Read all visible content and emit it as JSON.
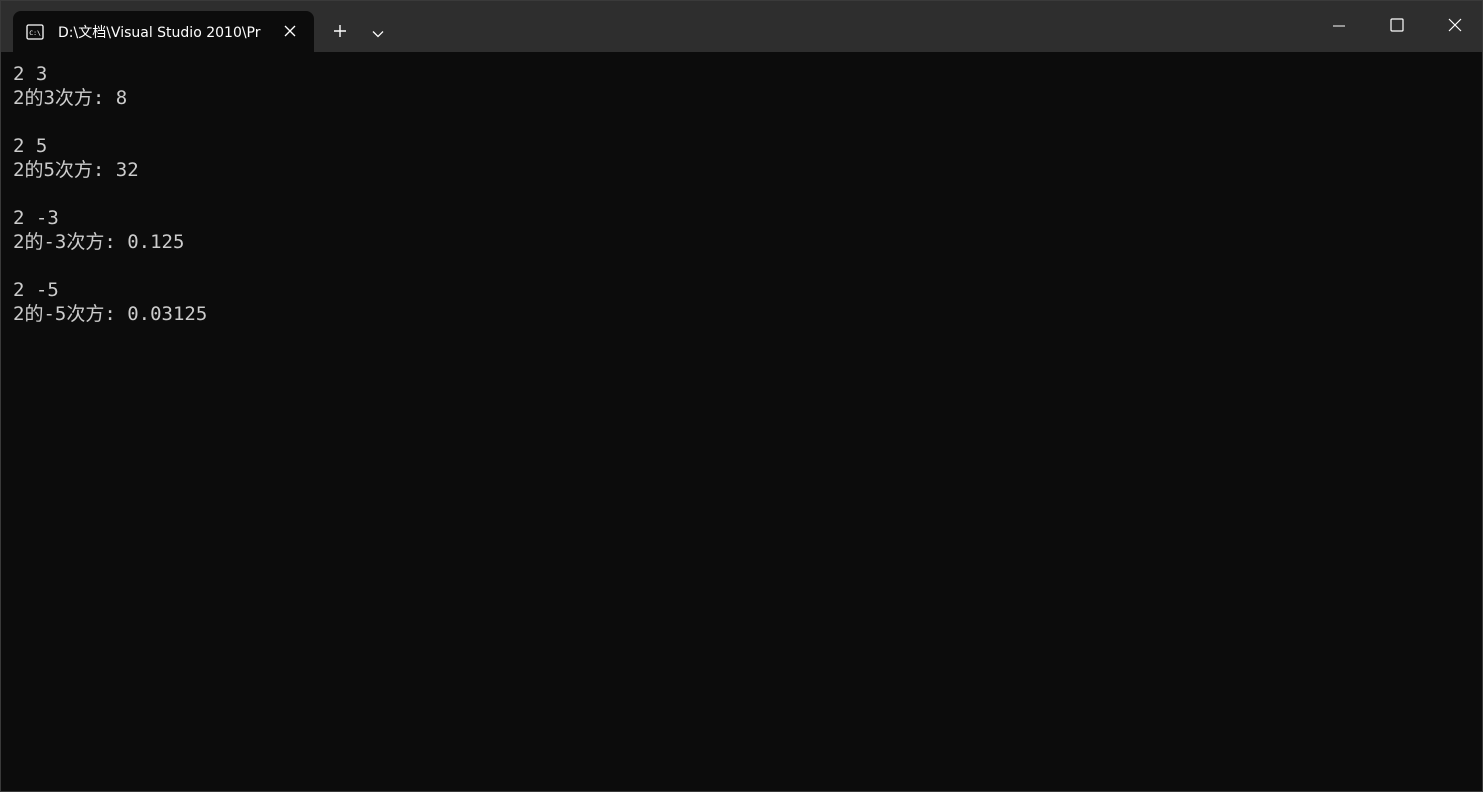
{
  "window": {
    "tab_title": "D:\\文档\\Visual Studio 2010\\Pr",
    "tab_icon": "console-icon",
    "new_tab_icon": "plus-icon",
    "dropdown_icon": "chevron-down-icon",
    "minimize_icon": "minimize-icon",
    "maximize_icon": "maximize-icon",
    "close_icon": "close-icon"
  },
  "console": {
    "lines": [
      "2 3",
      "2的3次方: 8",
      "",
      "2 5",
      "2的5次方: 32",
      "",
      "2 -3",
      "2的-3次方: 0.125",
      "",
      "2 -5",
      "2的-5次方: 0.03125"
    ]
  },
  "colors": {
    "console_bg": "#0c0c0c",
    "console_text": "#cccccc",
    "titlebar_bg": "#2e2e2e",
    "tab_text": "#ffffff"
  }
}
